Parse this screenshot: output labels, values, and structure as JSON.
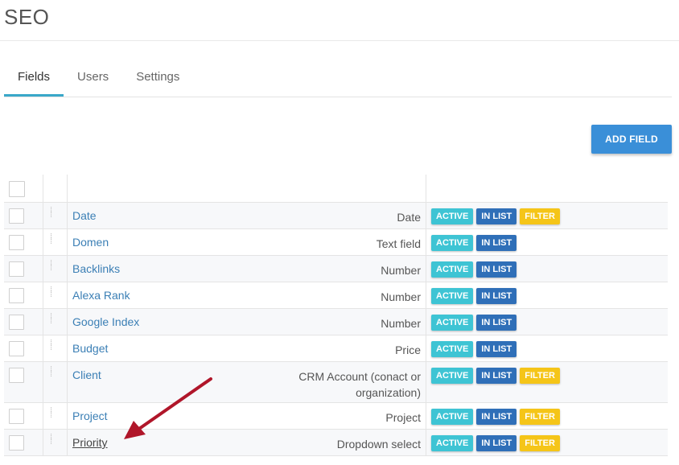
{
  "page": {
    "title": "SEO"
  },
  "tabs": [
    {
      "label": "Fields",
      "active": true
    },
    {
      "label": "Users",
      "active": false
    },
    {
      "label": "Settings",
      "active": false
    }
  ],
  "toolbar": {
    "add_field_label": "ADD FIELD"
  },
  "badges": {
    "active": "ACTIVE",
    "in_list": "IN LIST",
    "filter": "FILTER"
  },
  "colors": {
    "tab_accent": "#3aa8c9",
    "add_button": "#3a8fd8",
    "active_badge": "#3ec4d4",
    "in_list_badge": "#2f6fb8",
    "filter_badge": "#f5c518",
    "annotation_arrow": "#b0162a"
  },
  "fields": [
    {
      "name": "Date",
      "type": "Date",
      "active": true,
      "in_list": true,
      "filter": true
    },
    {
      "name": "Domen",
      "type": "Text field",
      "active": true,
      "in_list": true,
      "filter": false
    },
    {
      "name": "Backlinks",
      "type": "Number",
      "active": true,
      "in_list": true,
      "filter": false
    },
    {
      "name": "Alexa Rank",
      "type": "Number",
      "active": true,
      "in_list": true,
      "filter": false
    },
    {
      "name": "Google Index",
      "type": "Number",
      "active": true,
      "in_list": true,
      "filter": false
    },
    {
      "name": "Budget",
      "type": "Price",
      "active": true,
      "in_list": true,
      "filter": false
    },
    {
      "name": "Client",
      "type_line1": "CRM Account (conact or",
      "type_line2": "organization)",
      "active": true,
      "in_list": true,
      "filter": true
    },
    {
      "name": "Project",
      "type": "Project",
      "active": true,
      "in_list": true,
      "filter": true
    },
    {
      "name": "Priority",
      "type": "Dropdown select",
      "active": true,
      "in_list": true,
      "filter": true
    }
  ]
}
